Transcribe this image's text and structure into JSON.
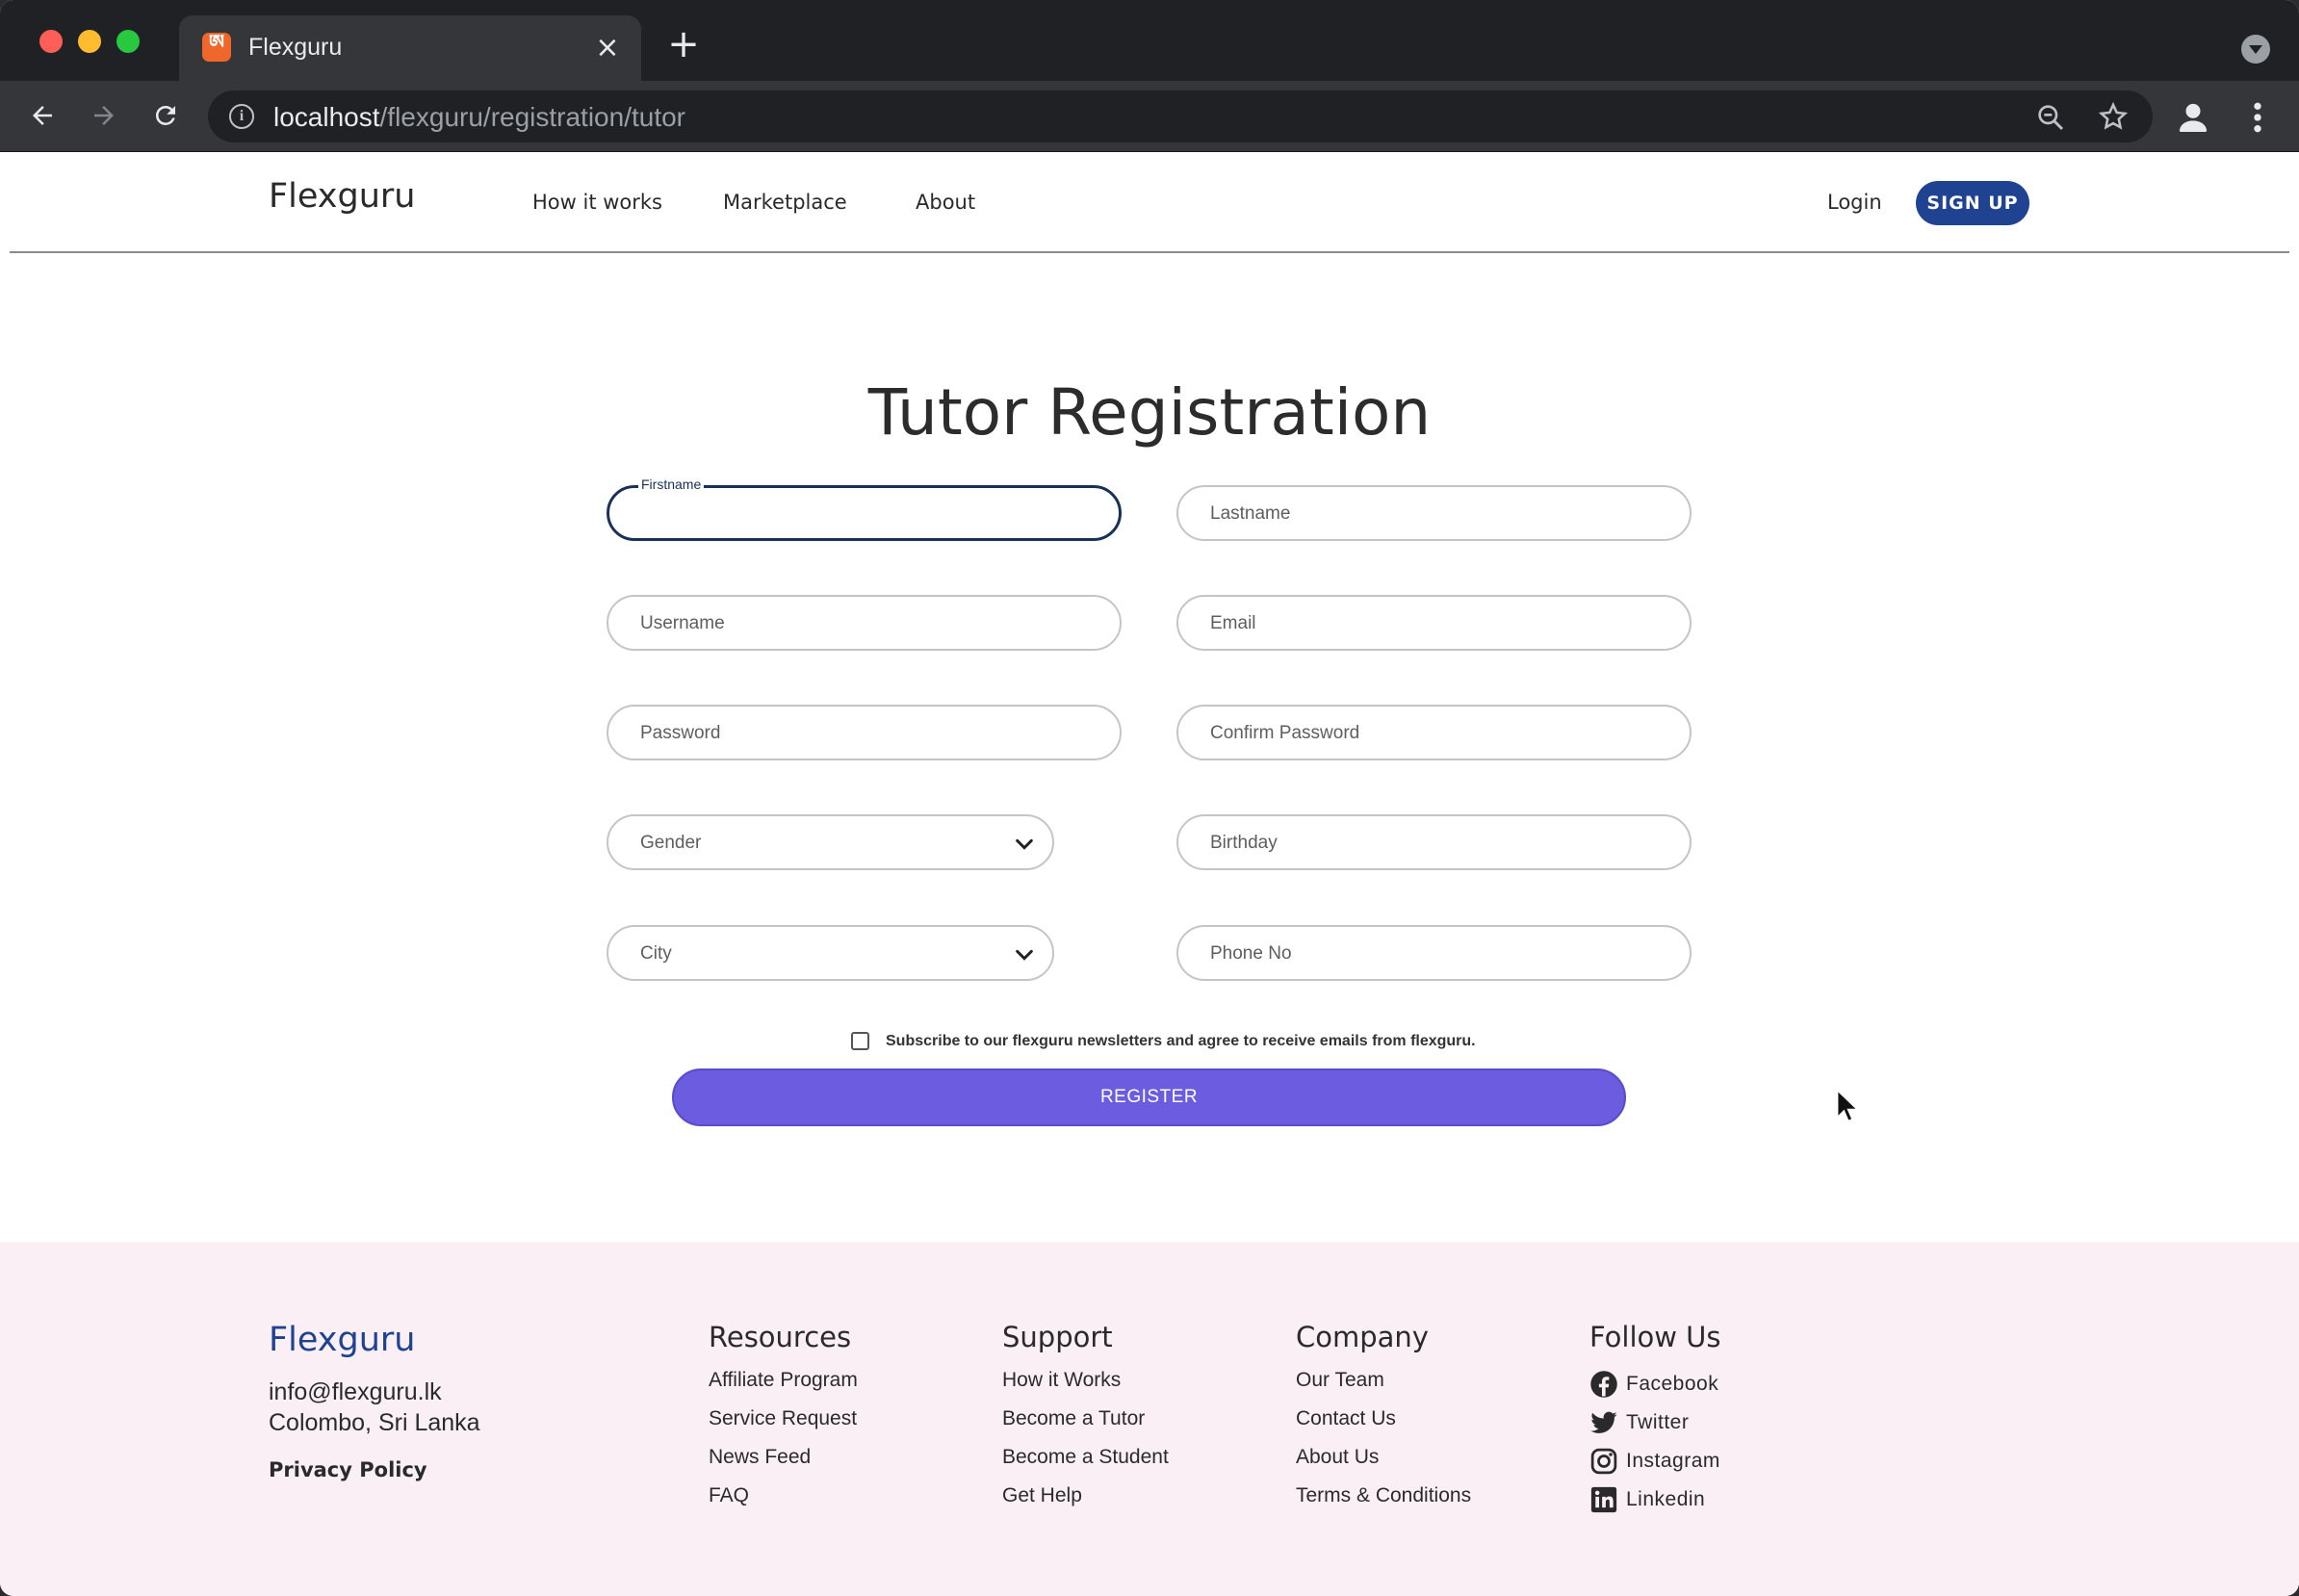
{
  "browser": {
    "tab_title": "Flexguru",
    "tab_favicon": "xampp-icon",
    "url_host": "localhost",
    "url_path": "/flexguru/registration/tutor"
  },
  "header": {
    "brand": "Flexguru",
    "nav": [
      "How it works",
      "Marketplace",
      "About"
    ],
    "login": "Login",
    "signup": "SIGN UP",
    "signup_color": "#1f4291"
  },
  "form": {
    "title": "Tutor Registration",
    "firstname_label": "Firstname",
    "lastname_placeholder": "Lastname",
    "username_placeholder": "Username",
    "email_placeholder": "Email",
    "password_placeholder": "Password",
    "confirm_password_placeholder": "Confirm Password",
    "gender_value": "Gender",
    "birthday_placeholder": "Birthday",
    "city_value": "City",
    "phone_placeholder": "Phone No",
    "subscribe_text": "Subscribe to our flexguru newsletters and agree to receive emails from flexguru.",
    "subscribe_checked": false,
    "register_label": "REGISTER",
    "register_color": "#6b5ce0"
  },
  "footer": {
    "brand": "Flexguru",
    "email": "info@flexguru.lk",
    "location": "Colombo, Sri Lanka",
    "privacy": "Privacy Policy",
    "background": "#fbeff6",
    "resources": {
      "title": "Resources",
      "links": [
        "Affiliate Program",
        "Service Request",
        "News Feed",
        "FAQ"
      ]
    },
    "support": {
      "title": "Support",
      "links": [
        "How it Works",
        "Become a Tutor",
        "Become a Student",
        "Get Help"
      ]
    },
    "company": {
      "title": "Company",
      "links": [
        "Our Team",
        "Contact Us",
        "About Us",
        "Terms & Conditions"
      ]
    },
    "follow": {
      "title": "Follow Us",
      "links": [
        {
          "label": "Facebook",
          "icon": "facebook-icon"
        },
        {
          "label": "Twitter",
          "icon": "twitter-icon"
        },
        {
          "label": "Instagram",
          "icon": "instagram-icon"
        },
        {
          "label": "Linkedin",
          "icon": "linkedin-icon"
        }
      ]
    }
  }
}
